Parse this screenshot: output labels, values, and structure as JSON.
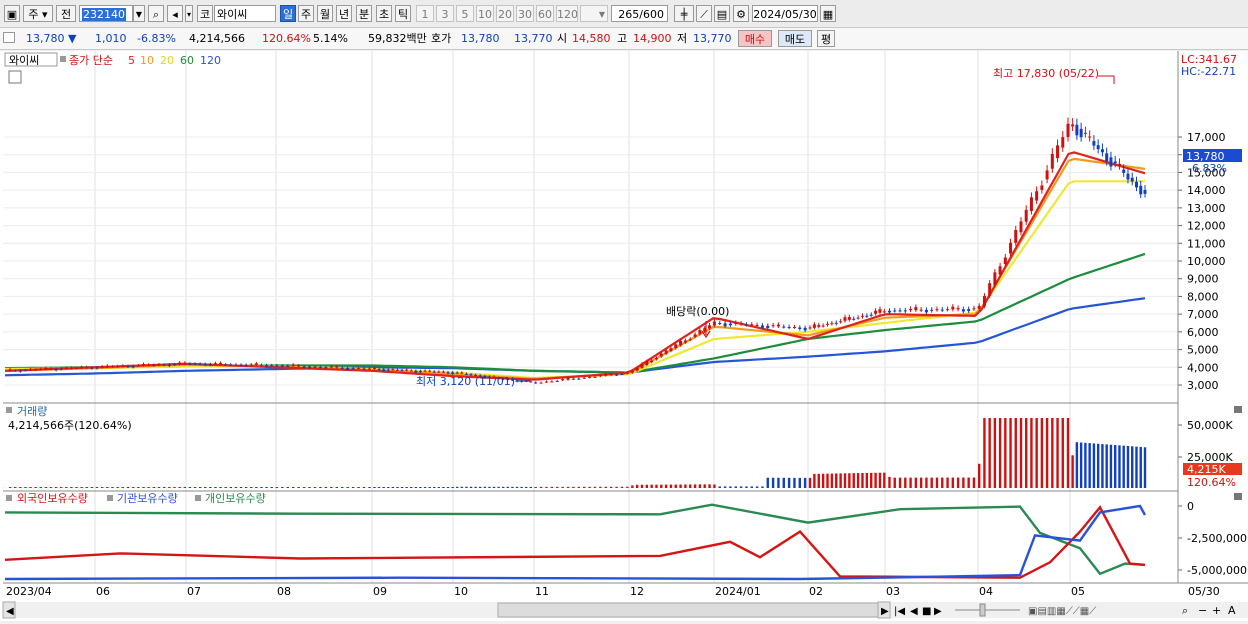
{
  "toolbar": {
    "market": "주",
    "prev": "전",
    "code": "232140",
    "kind": "코",
    "name": "와이씨",
    "periods": [
      "일",
      "주",
      "월",
      "년",
      "분",
      "초",
      "틱"
    ],
    "active_period": "일",
    "intervals": [
      "1",
      "3",
      "5",
      "10",
      "20",
      "30",
      "60",
      "120"
    ],
    "count": "265",
    "count_total": "/600",
    "date": "2024/05/30"
  },
  "quote": {
    "price": "13,780",
    "arrow": "▼",
    "change": "1,010",
    "change_pct": "-6.83%",
    "volume": "4,214,566",
    "volume_ratio": "120.64%",
    "turnover": "5.14%",
    "amount": "59,832백만",
    "bid_label": "호가",
    "bid1": "13,780",
    "bid2": "13,770",
    "open_label": "시",
    "open": "14,580",
    "high_label": "고",
    "high": "14,900",
    "low_label": "저",
    "low": "13,770",
    "buy": "매수",
    "sell": "매도",
    "avg": "평"
  },
  "colors": {
    "rise": "#d01010",
    "fall": "#1040c0",
    "ma5": "#e0231e",
    "ma10": "#f39a1c",
    "ma20": "#f0e830",
    "ma60": "#1e8c3a",
    "ma120": "#2456d6",
    "foreign": "#d51515",
    "institution": "#2a52d8",
    "individual": "#2a8a52"
  },
  "price_panel": {
    "name": "와이씨",
    "ma_title": "종가 단순",
    "ma_periods": [
      "5",
      "10",
      "20",
      "60",
      "120"
    ],
    "lc": "LC:341.67",
    "hc": "HC:-22.71",
    "price_tag": "13,780",
    "pct_tag": "-6.83%",
    "max_annot": "최고 17,830 (05/22)",
    "min_annot": "최저 3,120 (11/01)",
    "div_annot": "배당락(0.00)"
  },
  "volume_panel": {
    "title": "거래량",
    "value": "4,214,566주(120.64%)",
    "tag": "4,215K",
    "tag_pct": "120.64%"
  },
  "holding_panel": {
    "series_labels": [
      "외국인보유수량",
      "기관보유수량",
      "개인보유수량"
    ]
  },
  "x_axis": {
    "labels": [
      "2023/04",
      "06",
      "07",
      "08",
      "09",
      "10",
      "11",
      "12",
      "2024/01",
      "02",
      "03",
      "04",
      "05"
    ],
    "end_label": "05/30"
  },
  "chart_data": [
    {
      "type": "candlestick",
      "title": "와이씨",
      "x_range": [
        "2023/04",
        "2024/05/30"
      ],
      "ylim": [
        2500,
        18200
      ],
      "y_ticks": [
        3000,
        4000,
        5000,
        6000,
        7000,
        8000,
        9000,
        10000,
        11000,
        12000,
        13000,
        14000,
        15000,
        16000,
        17000
      ],
      "close_series": {
        "name": "종가",
        "x": [
          "2023/04",
          "06",
          "07",
          "08",
          "09",
          "10",
          "11/01",
          "12",
          "2024/01",
          "02",
          "03",
          "04",
          "05/22",
          "05/30"
        ],
        "values": [
          3800,
          4000,
          4200,
          4100,
          3900,
          3700,
          3120,
          3700,
          6500,
          6200,
          7200,
          7300,
          17830,
          13780
        ]
      },
      "moving_averages": [
        {
          "name": "5",
          "values": [
            3800,
            4000,
            4200,
            4000,
            3800,
            3500,
            3300,
            3700,
            6800,
            5600,
            7000,
            6900,
            16200,
            14950
          ]
        },
        {
          "name": "10",
          "values": [
            3800,
            3950,
            4150,
            4050,
            3850,
            3600,
            3350,
            3650,
            6300,
            5800,
            6800,
            7000,
            15800,
            15200
          ]
        },
        {
          "name": "20",
          "values": [
            3900,
            3950,
            4050,
            4050,
            3900,
            3700,
            3400,
            3600,
            5600,
            6000,
            6500,
            7100,
            14500,
            14500
          ]
        },
        {
          "name": "60",
          "values": [
            3950,
            4000,
            4050,
            4100,
            4100,
            4000,
            3800,
            3700,
            4500,
            5600,
            6100,
            6600,
            9000,
            10400
          ]
        },
        {
          "name": "120",
          "values": [
            3550,
            3650,
            3800,
            3900,
            4000,
            3950,
            3800,
            3700,
            4300,
            4600,
            4900,
            5400,
            7300,
            7900
          ]
        }
      ],
      "annotations": [
        "최고 17,830 (05/22)",
        "최저 3,120 (11/01)",
        "배당락(0.00)"
      ],
      "last": 13780,
      "last_change_pct": -6.83
    },
    {
      "type": "bar",
      "title": "거래량",
      "ylim": [
        0,
        60000
      ],
      "unit": "K",
      "y_ticks": [
        "50,000K",
        "25,000K"
      ],
      "last": 4215
    },
    {
      "type": "line",
      "series_names": [
        "외국인보유수량",
        "기관보유수량",
        "개인보유수량"
      ],
      "ylim": [
        -5500000,
        500000
      ],
      "y_ticks": [
        "0",
        "-2,500,000",
        "-5,000,000"
      ]
    }
  ]
}
